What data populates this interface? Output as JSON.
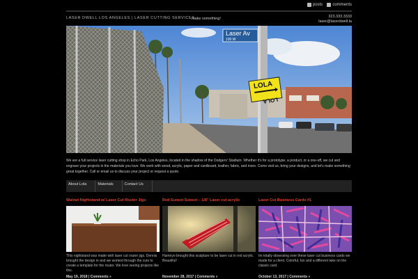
{
  "feeds": {
    "posts_label": "posts",
    "comments_label": "comments"
  },
  "header": {
    "site_title": "Laser Dwell Los Angeles | Laser Cutting Services",
    "tagline": "make something!",
    "phone": "323.333.3333",
    "email": "laser@laserdwell.la"
  },
  "hero": {
    "street_sign_name": "Laser Av",
    "street_sign_number": "100 W",
    "lola_top": "LOLA",
    "lola_bottom": "LOLA"
  },
  "intro": {
    "text": "We are a full service laser cutting shop in Echo Park, Los Angeles, located in the shadow of the Dodgers' Stadium. Whether it's for a prototype, a product, or a one-off, we cut and engrave your projects in the materials you love. We work with wood, acrylic, paper and cardboard, leather, fabric, and more. Come visit us, bring your designs, and let's make something great together. Call or email us to discuss your project or request a quote."
  },
  "nav": {
    "items": [
      "About Lola",
      "Materials",
      "Contact Us"
    ]
  },
  "posts": [
    {
      "title": "Walnut Nightstand w/ Laser Cut Router Jigs",
      "excerpt": "This nightstand was made with laser cut router jigs. Dennis brought the design in and we worked through the cuts to create a template for the router. We love seeing projects like this.",
      "meta": "May 19, 2018 | Comments »"
    },
    {
      "title": "Red Sunset Sunset – 1/8\" Laser cut acrylic",
      "excerpt": "Hamnyo brought this sculpture to be laser cut in red acrylic. Beautiful!",
      "meta": "November 28, 2017 | Comments »"
    },
    {
      "title": "Laser Cut Business Cards #1",
      "excerpt": "Im totally obsessing over these laser cut business cards we made for a client. Colorful, fun and a different take on the classic card.",
      "meta": "October 13, 2017 | Comments »"
    }
  ]
}
